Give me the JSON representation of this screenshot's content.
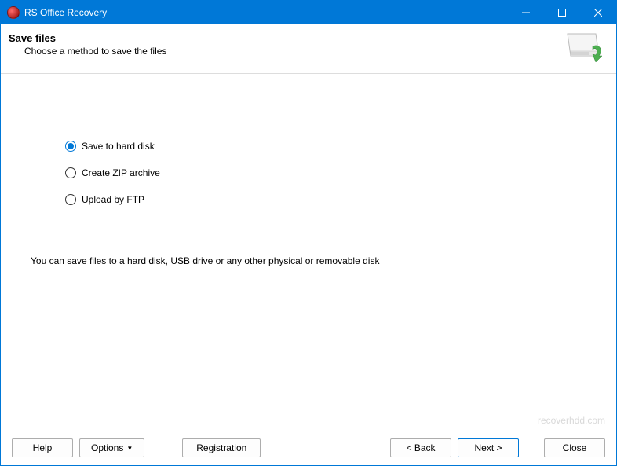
{
  "titlebar": {
    "title": "RS Office Recovery"
  },
  "header": {
    "title": "Save files",
    "subtitle": "Choose a method to save the files"
  },
  "options": [
    {
      "label": "Save to hard disk",
      "selected": true
    },
    {
      "label": "Create ZIP archive",
      "selected": false
    },
    {
      "label": "Upload by FTP",
      "selected": false
    }
  ],
  "description": "You can save files to a hard disk, USB drive or any other physical or removable disk",
  "watermark": "recoverhdd.com",
  "footer": {
    "help": "Help",
    "options": "Options",
    "registration": "Registration",
    "back": "< Back",
    "next": "Next >",
    "close": "Close"
  }
}
